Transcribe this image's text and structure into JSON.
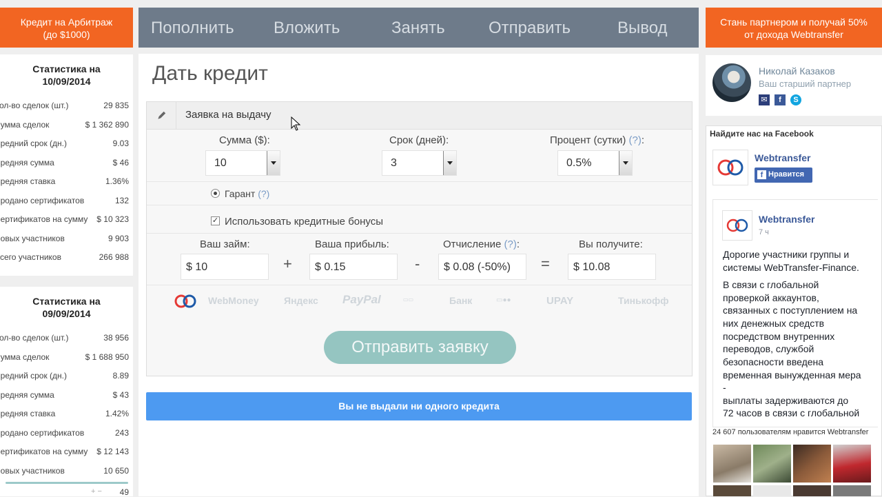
{
  "left_banner": {
    "line1": "Кредит на Арбитраж",
    "line2": "(до $1000)"
  },
  "stats": [
    {
      "title_line1": "Статистика на",
      "title_line2": "10/09/2014",
      "rows": [
        {
          "label": "Кол-во сделок (шт.)",
          "value": "29 835"
        },
        {
          "label": "Сумма сделок",
          "value": "$ 1 362 890"
        },
        {
          "label": "Средний срок (дн.)",
          "value": "9.03"
        },
        {
          "label": "Средняя сумма",
          "value": "$ 46"
        },
        {
          "label": "Средняя ставка",
          "value": "1.36%"
        },
        {
          "label": "Продано сертификатов",
          "value": "132"
        },
        {
          "label": "Сертификатов на сумму",
          "value": "$ 10 323"
        },
        {
          "label": "Новых участников",
          "value": "9 903"
        },
        {
          "label": "Всего участников",
          "value": "266 988"
        }
      ]
    },
    {
      "title_line1": "Статистика на",
      "title_line2": "09/09/2014",
      "rows": [
        {
          "label": "Кол-во сделок (шт.)",
          "value": "38 956"
        },
        {
          "label": "Сумма сделок",
          "value": "$ 1 688 950"
        },
        {
          "label": "Средний срок (дн.)",
          "value": "8.89"
        },
        {
          "label": "Средняя сумма",
          "value": "$ 43"
        },
        {
          "label": "Средняя ставка",
          "value": "1.42%"
        },
        {
          "label": "Продано сертификатов",
          "value": "243"
        },
        {
          "label": "Сертификатов на сумму",
          "value": "$ 12 143"
        },
        {
          "label": "Новых участников",
          "value": "10 650"
        }
      ],
      "partial_last_value": "49"
    }
  ],
  "nav": [
    "Пополнить",
    "Вложить",
    "Занять",
    "Отправить",
    "Вывод"
  ],
  "right_banner": {
    "line1": "Стань партнером и получай 50%",
    "line2": "от дохода Webtransfer"
  },
  "partner": {
    "name": "Николай Казаков",
    "role": "Ваш старший партнер"
  },
  "facebook": {
    "header": "Найдите нас на Facebook",
    "page_name": "Webtransfer",
    "like_label": "Нравится",
    "post_author": "Webtransfer",
    "post_time": "7 ч",
    "post_lines": [
      "Дорогие участники группы и",
      "системы WebTransfer-Finance.",
      "В связи с глобальной",
      "проверкой аккаунтов,",
      "связанных с поступлением на",
      "них денежных средств",
      "посредством внутренних",
      "переводов, службой",
      "безопасности введена",
      "временная вынужденная мера",
      "-",
      "выплаты задерживаются до",
      "72 часов в связи с глобальной"
    ],
    "likes_text": "24 607 пользователям нравится Webtransfer"
  },
  "page": {
    "title": "Дать кредит"
  },
  "form": {
    "header": "Заявка на выдачу",
    "amount": {
      "label": "Сумма ($):",
      "value": "10"
    },
    "term": {
      "label": "Срок (дней):",
      "value": "3"
    },
    "rate": {
      "label": "Процент (сутки)",
      "help": "(?)",
      "colon": ":",
      "value": "0.5%"
    },
    "guarantee": {
      "label": "Гарант",
      "help": "(?)"
    },
    "bonus": {
      "label": "Использовать кредитные бонусы",
      "check": "✓"
    },
    "loan": {
      "label": "Ваш займ:",
      "value": "$ 10"
    },
    "profit": {
      "label": "Ваша прибыль:",
      "value": "$ 0.15"
    },
    "deduction": {
      "label": "Отчисление",
      "help": "(?)",
      "colon": ":",
      "value": "$ 0.08 (-50%)"
    },
    "receive": {
      "label": "Вы получите:",
      "value": "$ 10.08"
    },
    "ops": {
      "plus": "+",
      "minus": "-",
      "equals": "="
    },
    "payment_methods": [
      "WebMoney",
      "Яндекс",
      "PayPal",
      "Банк",
      "UPAY",
      "Тинькофф"
    ],
    "submit_label": "Отправить заявку"
  },
  "notice": "Вы не выдали ни одного кредита",
  "colors": {
    "orange": "#f26522",
    "nav_bg": "#6e7b8a",
    "submit": "#95c5c1",
    "notice": "#4d9af1"
  }
}
